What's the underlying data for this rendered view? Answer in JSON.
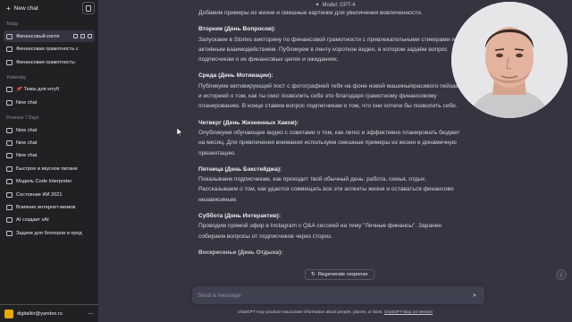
{
  "sidebar": {
    "new_chat": "New chat",
    "sections": [
      {
        "title": "Today",
        "items": [
          {
            "label": "Финансовый конте",
            "active": true
          },
          {
            "label": "Финансовая грамотность с"
          },
          {
            "label": "Финансовая грамотность:"
          }
        ]
      },
      {
        "title": "Yesterday",
        "items": [
          {
            "label": "📌 Темы для ютуб"
          },
          {
            "label": "New chat"
          }
        ]
      },
      {
        "title": "Previous 7 Days",
        "items": [
          {
            "label": "New chat"
          },
          {
            "label": "New chat"
          },
          {
            "label": "New chat"
          },
          {
            "label": "Быстрое и вкусное питани"
          },
          {
            "label": "Модель Code Interpreter"
          },
          {
            "label": "Состояние ИИ 2021"
          },
          {
            "label": "Влияние интернет-мемов"
          },
          {
            "label": "AI создает xAI"
          },
          {
            "label": "Задачи для блогеров и прод"
          }
        ]
      }
    ],
    "user_email": "digitalkir@yandex.ru",
    "user_menu_icon": "ellipsis-icon"
  },
  "header": {
    "model_label": "Model: GPT-4"
  },
  "messages": [
    {
      "body": "Добавим примеры из жизни и смешные картинки для увеличения вовлеченности."
    },
    {
      "heading": "Вторник (День Вопросов):",
      "body": "Запускаем в Stories викторину по финансовой грамотности с привлекательными стикерами и активным взаимодействием. Публикуем в ленту короткое видео, в котором задаём вопрос подписчикам о их финансовых целях и ожиданиях."
    },
    {
      "heading": "Среда (День Мотивации):",
      "body": "Публикуем мотивирующий пост с фотографией тебя на фоне новой машины/красивого пейзажа и историей о том, как ты смог позволить себе это благодаря грамотному финансовому планированию. В конце ставим вопрос подписчикам о том, что они хотели бы позволить себе."
    },
    {
      "heading": "Четверг (День Жизненных Хаков):",
      "body": "Опубликуем обучающее видео с советами о том, как легко и эффективно планировать бюджет на месяц. Для привлечения внимания используем смешные примеры из жизни и динамичную презентацию."
    },
    {
      "heading": "Пятница (День Бэкстейджа):",
      "body": "Показываем подписчикам, как проходит твой обычный день: работа, семья, отдых. Рассказываем о том, как удается совмещать все эти аспекты жизни и оставаться финансово независимым."
    },
    {
      "heading": "Суббота (День Интерактив):",
      "body": "Проводим прямой эфир в Instagram с Q&A сессией на тему \"Личные финансы\". Заранее собираем вопросы от подписчиков через сториз."
    },
    {
      "heading": "Воскресенье (День Отдыха):",
      "body": ""
    }
  ],
  "composer": {
    "regenerate_label": "Regenerate response",
    "placeholder": "Send a message",
    "value": ""
  },
  "footer": {
    "text": "ChatGPT may produce inaccurate information about people, places, or facts. ",
    "link": "ChatGPT May 24 Version"
  },
  "colors": {
    "sidebar_bg": "#202123",
    "main_bg": "#343541",
    "input_bg": "#40414f",
    "avatar": "#e8a800"
  }
}
